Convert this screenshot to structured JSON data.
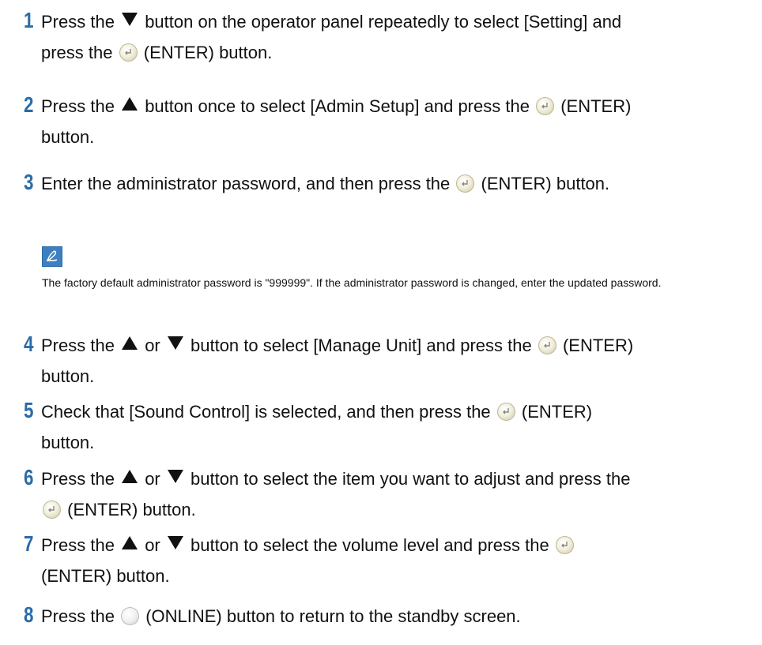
{
  "steps": [
    {
      "num": "1",
      "lines": [
        "Press the",
        "button on the operator panel repeatedly to select [Setting] and",
        "press the",
        "(ENTER) button."
      ]
    },
    {
      "num": "2",
      "lines": [
        "Press the",
        "button once to select [Admin Setup] and press the",
        "(ENTER)",
        "button."
      ]
    },
    {
      "num": "3",
      "lines": [
        "Enter the administrator password, and then press the",
        "(ENTER) button."
      ]
    },
    {
      "num": "4",
      "lines": [
        "Press the",
        "or",
        "button to select [Manage Unit] and press the",
        "(ENTER)",
        "button."
      ]
    },
    {
      "num": "5",
      "lines": [
        "Check that [Sound Control] is selected, and then press the",
        "(ENTER)",
        "button."
      ]
    },
    {
      "num": "6",
      "lines": [
        "Press the",
        "or",
        "button to select the item you want to adjust and press the",
        "(ENTER) button."
      ]
    },
    {
      "num": "7",
      "lines": [
        "Press the",
        "or",
        "button to select the volume level and press the",
        "(ENTER) button."
      ]
    },
    {
      "num": "8",
      "lines": [
        "Press the",
        "(ONLINE) button to return to the standby screen."
      ]
    }
  ],
  "note": {
    "icon": "memo-pen-icon",
    "text": "The factory default administrator password is \"999999\". If the administrator password is changed, enter the updated password."
  },
  "colors": {
    "step_number": "#2a6ca8",
    "memo_icon_bg": "#3d7fc1"
  },
  "icons": {
    "down": "down-triangle-icon",
    "up": "up-triangle-icon",
    "enter": "enter-button-icon",
    "online": "online-button-icon"
  }
}
